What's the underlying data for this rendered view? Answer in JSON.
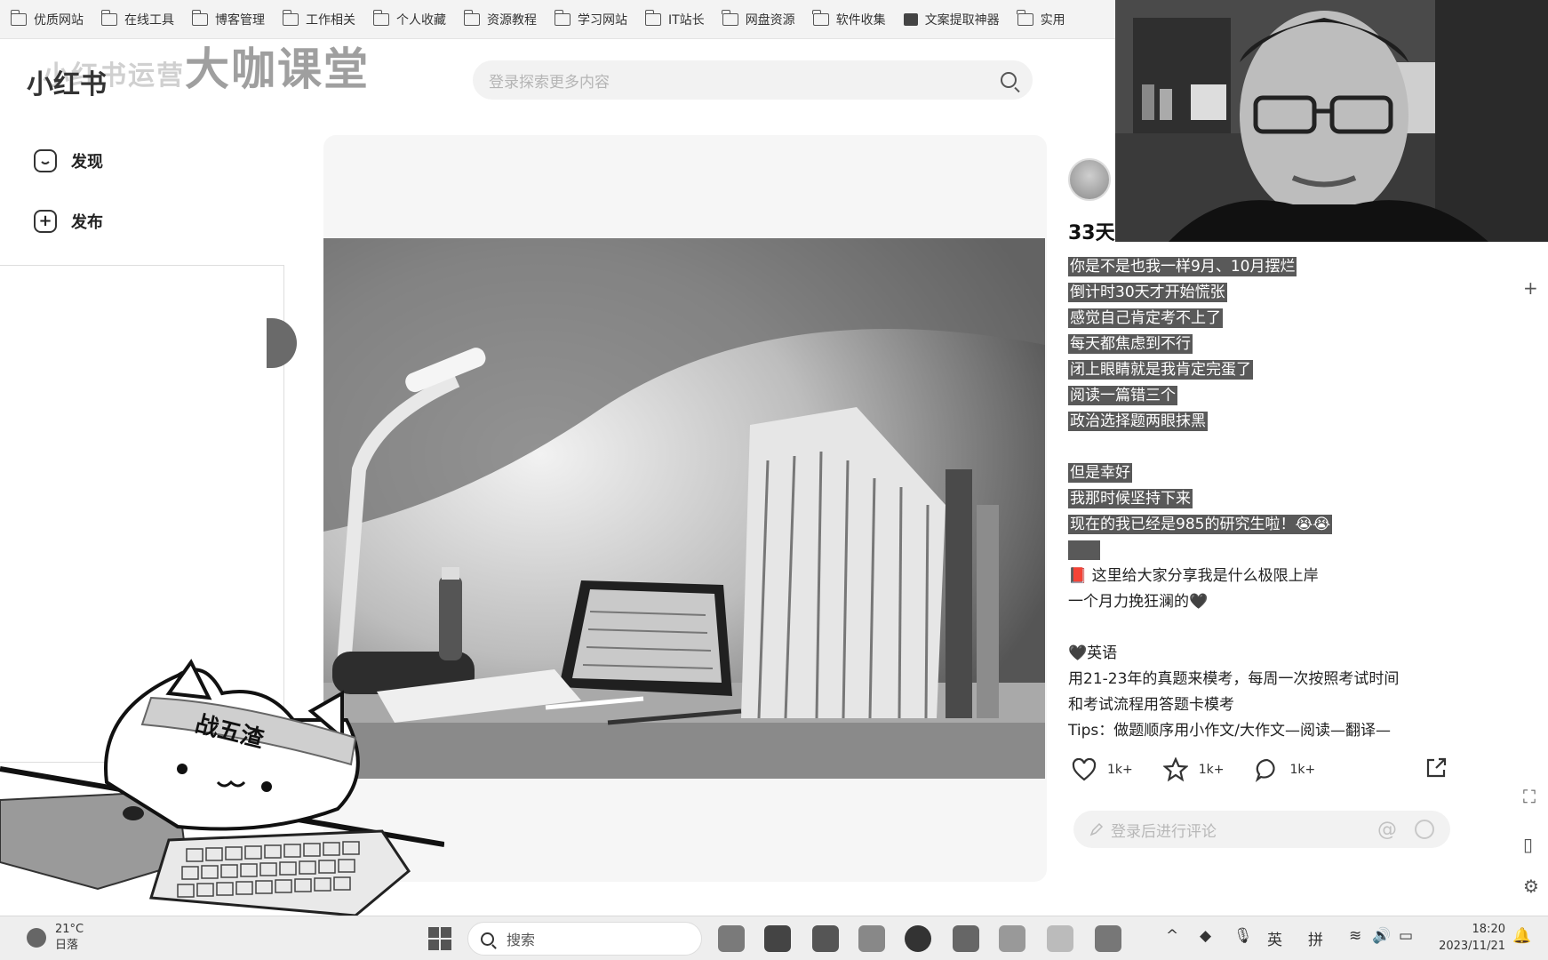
{
  "bookmarks": [
    {
      "label": "优质网站",
      "icon": "folder-icon"
    },
    {
      "label": "在线工具",
      "icon": "folder-icon"
    },
    {
      "label": "博客管理",
      "icon": "folder-icon"
    },
    {
      "label": "工作相关",
      "icon": "folder-icon"
    },
    {
      "label": "个人收藏",
      "icon": "folder-icon"
    },
    {
      "label": "资源教程",
      "icon": "folder-icon"
    },
    {
      "label": "学习网站",
      "icon": "folder-icon"
    },
    {
      "label": "IT站长",
      "icon": "folder-icon"
    },
    {
      "label": "网盘资源",
      "icon": "folder-icon"
    },
    {
      "label": "软件收集",
      "icon": "folder-icon"
    },
    {
      "label": "文案提取神器",
      "icon": "app-icon"
    },
    {
      "label": "实用",
      "icon": "folder-icon"
    }
  ],
  "watermark": {
    "small": "小红书运营",
    "big": "大咖课堂"
  },
  "app": {
    "logo": "小红书"
  },
  "nav": {
    "discover": "发现",
    "publish": "发布"
  },
  "search": {
    "placeholder": "登录探索更多内容"
  },
  "note": {
    "title": "33天",
    "lines": [
      {
        "text": "你是不是也我一样9月、10月摆烂",
        "hl": true
      },
      {
        "text": "倒计时30天才开始慌张",
        "hl": true
      },
      {
        "text": "感觉自己肯定考不上了",
        "hl": true
      },
      {
        "text": "每天都焦虑到不行",
        "hl": true
      },
      {
        "text": "闭上眼睛就是我肯定完蛋了",
        "hl": true
      },
      {
        "text": "阅读一篇错三个",
        "hl": true
      },
      {
        "text": "政治选择题两眼抹黑",
        "hl": true
      },
      {
        "text": "",
        "hl": false
      },
      {
        "text": "但是幸好",
        "hl": true
      },
      {
        "text": "我那时候坚持下来",
        "hl": true
      },
      {
        "text": "现在的我已经是985的研究生啦！😭😭",
        "hl": true
      },
      {
        "text": "",
        "hl": true
      },
      {
        "text": "📕 这里给大家分享我是什么极限上岸",
        "hl": false
      },
      {
        "text": "一个月力挽狂澜的🖤",
        "hl": false
      },
      {
        "text": "",
        "hl": false
      },
      {
        "text": "🖤英语",
        "hl": false
      },
      {
        "text": "用21-23年的真题来模考，每周一次按照考试时间",
        "hl": false
      },
      {
        "text": "和考试流程用答题卡模考",
        "hl": false
      },
      {
        "text": "Tips：做题顺序用小作文/大作文—阅读—翻译—",
        "hl": false
      }
    ],
    "likes": "1k+",
    "collects": "1k+",
    "comments": "1k+",
    "comment_placeholder": "登录后进行评论",
    "comment_at": "@"
  },
  "sticker": {
    "banner": "战五渣"
  },
  "taskbar": {
    "temp": "21°C",
    "weather": "日落",
    "search": "搜索",
    "ime_lang": "英",
    "ime_mode": "拼",
    "time": "18:20",
    "date": "2023/11/21"
  },
  "colors": {
    "highlight": "#595959",
    "bg": "#ffffff"
  }
}
